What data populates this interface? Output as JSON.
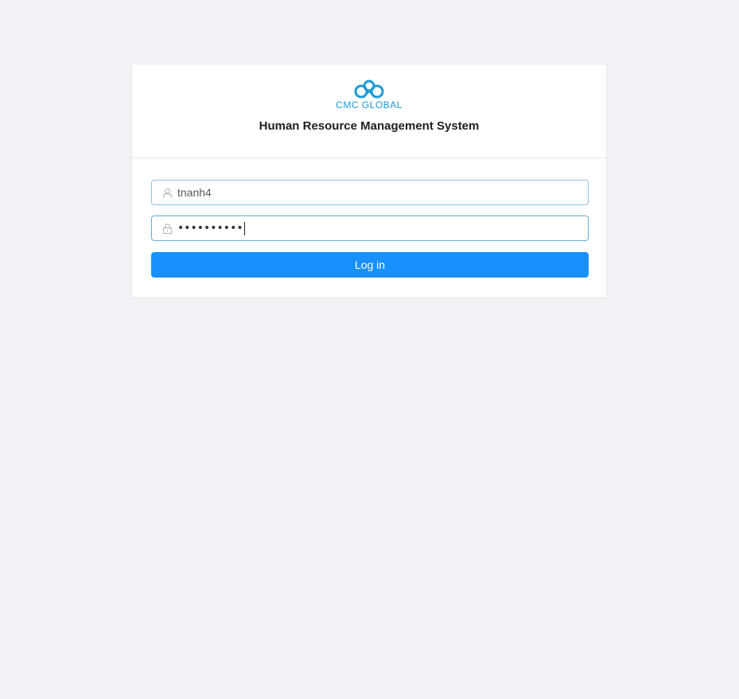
{
  "header": {
    "logo_text": "CMC GLOBAL",
    "title": "Human Resource Management System"
  },
  "form": {
    "username": {
      "value": "tnanh4",
      "icon": "user-icon"
    },
    "password": {
      "masked_value": "••••••••••",
      "icon": "lock-icon"
    },
    "login_label": "Log in"
  },
  "colors": {
    "page_bg": "#f0f2f5",
    "primary": "#1890ff",
    "brand": "#1e9ad6"
  }
}
